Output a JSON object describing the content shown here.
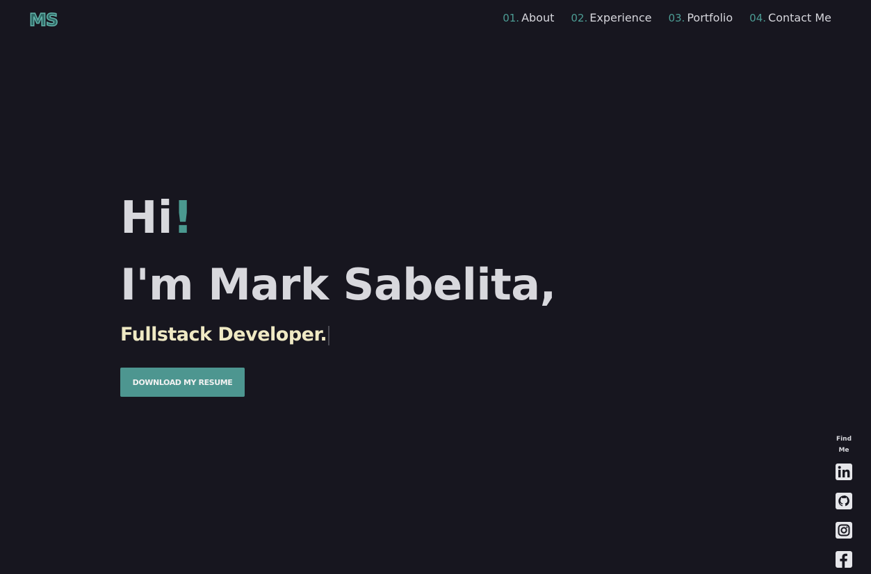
{
  "logo": {
    "text": "MS"
  },
  "nav": {
    "items": [
      {
        "num": "01.",
        "label": "About"
      },
      {
        "num": "02.",
        "label": "Experience"
      },
      {
        "num": "03.",
        "label": "Portfolio"
      },
      {
        "num": "04.",
        "label": "Contact Me"
      }
    ]
  },
  "hero": {
    "greeting": "Hi",
    "greeting_accent": "!",
    "name_line": "I'm Mark Sabelita,",
    "role": "Fullstack Developer.",
    "button_label": "DOWNLOAD MY RESUME"
  },
  "social": {
    "title": "Find Me",
    "icons": [
      "linkedin-icon",
      "github-icon",
      "instagram-icon",
      "facebook-icon"
    ]
  },
  "colors": {
    "background": "#17161f",
    "accent": "#4b9990",
    "text": "#d8d8dd",
    "role_text": "#efe9c4",
    "button_bg": "#4d9690"
  }
}
